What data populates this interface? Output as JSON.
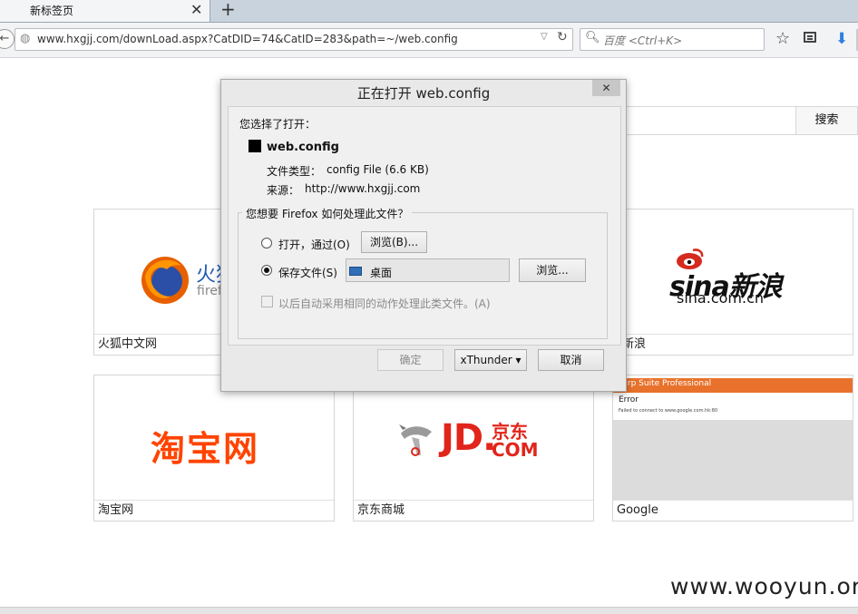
{
  "browser": {
    "tab": {
      "title": "新标签页",
      "close": "✕",
      "new_tab": "+"
    },
    "nav": {
      "back": "←",
      "url": "www.hxgjj.com/downLoad.aspx?CatDID=74&CatID=283&path=~/web.config",
      "reload": "↻",
      "search_placeholder": "百度 <Ctrl+K>",
      "bookmark_star": "☆",
      "download": "⬇"
    }
  },
  "page": {
    "search_button": "搜索",
    "tiles": [
      {
        "label": "火狐中文网",
        "logo_text": "火狐",
        "logo_sub": "firef"
      },
      {
        "label": "新浪",
        "logo_text": "sina新浪",
        "logo_sub": "sina.com.cn"
      },
      {
        "label": "淘宝网",
        "logo_text": "淘宝网"
      },
      {
        "label": "京东商城",
        "logo_text": "JD.",
        "logo_cn": "京东",
        "logo_com": "COM"
      },
      {
        "label": "Google",
        "preview_title": "Burp Suite Professional",
        "preview_heading": "Error",
        "preview_text": "Failed to connect to www.google.com.hk:80"
      }
    ],
    "watermark": "www.wooyun.org"
  },
  "dialog": {
    "title": "正在打开 web.config",
    "close": "✕",
    "you_chose": "您选择了打开：",
    "filename": "web.config",
    "file_type_label": "文件类型：",
    "file_type_value": "config File (6.6 KB)",
    "source_label": "来源：",
    "source_value": "http://www.hxgjj.com",
    "question": "您想要 Firefox 如何处理此文件？",
    "open_with_label": "打开，通过(O)",
    "browse1": "浏览(B)...",
    "save_label": "保存文件(S)",
    "save_target": "桌面",
    "browse2": "浏览...",
    "auto_label": "以后自动采用相同的动作处理此类文件。(A)",
    "ok": "确定",
    "xthunder": "xThunder ▾",
    "cancel": "取消"
  },
  "colors": {
    "firefox_orange": "#e66000",
    "sina_red": "#d52b1e",
    "taobao_orange": "#ff4400",
    "jd_red": "#e1251b",
    "burp_orange": "#e8722c"
  }
}
